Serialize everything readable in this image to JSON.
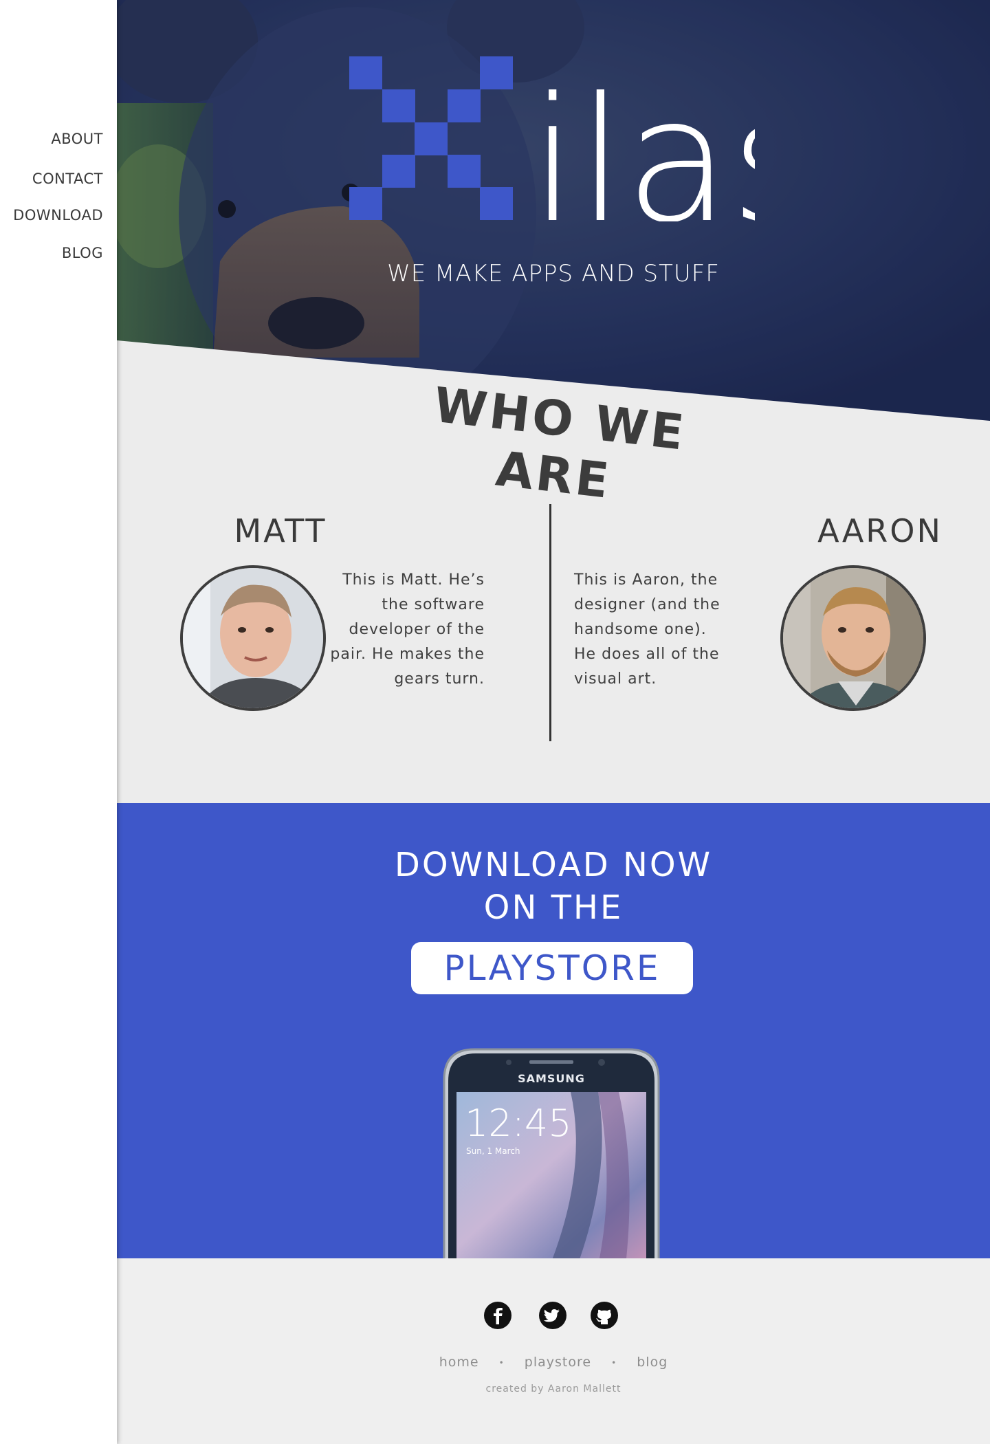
{
  "nav": {
    "items": [
      {
        "label": "ABOUT"
      },
      {
        "label": "CONTACT"
      },
      {
        "label": "DOWNLOAD"
      },
      {
        "label": "BLOG"
      }
    ]
  },
  "hero": {
    "logo_text": "ilas",
    "tagline": "WE MAKE APPS AND STUFF"
  },
  "who": {
    "title": "WHO WE ARE",
    "people": [
      {
        "name": "MATT",
        "bio": "This is Matt. He’s the software developer of the pair. He makes the gears turn."
      },
      {
        "name": "AARON",
        "bio": "This is Aaron, the designer (and the handsome one). He does all of the visual art."
      }
    ]
  },
  "download": {
    "line1": "DOWNLOAD NOW",
    "line2": "ON THE",
    "button": "PLAYSTORE",
    "phone": {
      "brand": "SAMSUNG",
      "time": "12:45",
      "date": "Sun, 1 March"
    }
  },
  "footer": {
    "social": [
      "facebook-icon",
      "twitter-icon",
      "github-icon"
    ],
    "links": [
      {
        "label": "home"
      },
      {
        "label": "playstore"
      },
      {
        "label": "blog"
      }
    ],
    "credit": "created by Aaron Mallett"
  },
  "colors": {
    "accent": "#3e57c9",
    "hero_overlay": "#1e2d5c",
    "text": "#3c3c3c"
  }
}
